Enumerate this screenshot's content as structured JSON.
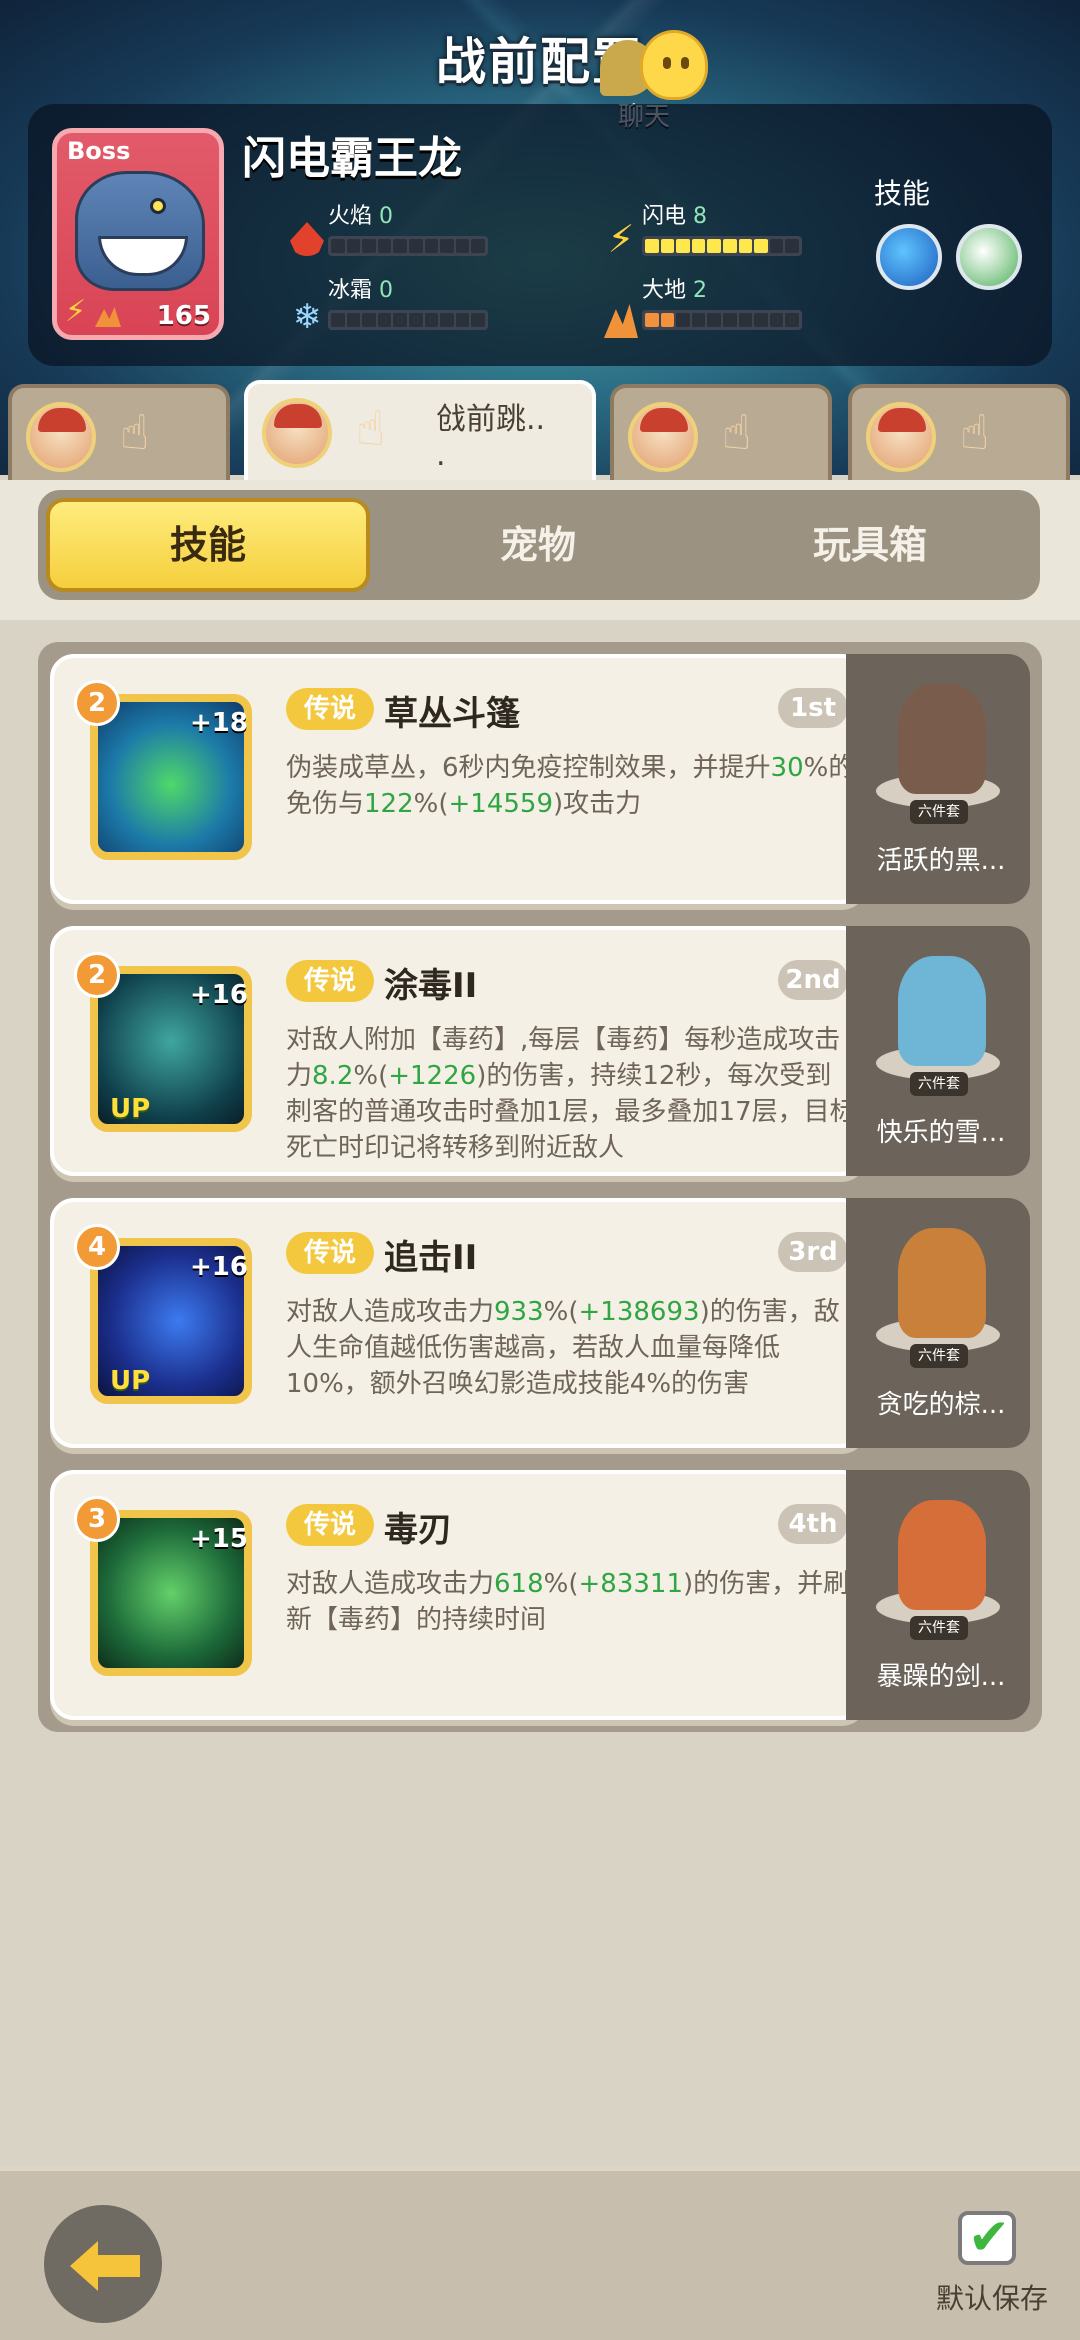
{
  "header": {
    "title": "战前配置",
    "chat_label": "聊天"
  },
  "boss": {
    "tag": "Boss",
    "name": "闪电霸王龙",
    "level": "165",
    "elements": [
      {
        "name": "火焰",
        "value": "0",
        "level": 0
      },
      {
        "name": "闪电",
        "value": "8",
        "level": 8
      },
      {
        "name": "冰霜",
        "value": "0",
        "level": 0
      },
      {
        "name": "大地",
        "value": "2",
        "level": 2
      }
    ],
    "skills_label": "技能"
  },
  "hero_tabs": [
    {
      "label": ""
    },
    {
      "label": "戗前跳..\n."
    },
    {
      "label": ""
    },
    {
      "label": ""
    }
  ],
  "subtabs": [
    "技能",
    "宠物",
    "玩具箱"
  ],
  "skills": [
    {
      "level": "2",
      "plus": "+18",
      "up": "",
      "rarity": "传说",
      "name": "草丛斗篷",
      "rank": "1st",
      "desc_parts": [
        "伪装成草丛，6秒内免疫控制效果，并提升",
        "30",
        "%的免伤与",
        "122",
        "%(",
        "+14559",
        ")攻击力"
      ],
      "pet_tag": "六件套",
      "pet_name": "活跃的黑..."
    },
    {
      "level": "2",
      "plus": "+16",
      "up": "UP",
      "rarity": "传说",
      "name": "涂毒II",
      "rank": "2nd",
      "desc_parts": [
        "对敌人附加【毒药】,每层【毒药】每秒造成攻击力",
        "8.2",
        "%(",
        "+1226",
        ")的伤害，持续12秒，每次受到刺客的普通攻击时叠加1层，最多叠加17层，目标死亡时印记将转移到附近敌人"
      ],
      "pet_tag": "六件套",
      "pet_name": "快乐的雪..."
    },
    {
      "level": "4",
      "plus": "+16",
      "up": "UP",
      "rarity": "传说",
      "name": "追击II",
      "rank": "3rd",
      "desc_parts": [
        "对敌人造成攻击力",
        "933",
        "%(",
        "+138693",
        ")的伤害，敌人生命值越低伤害越高，若敌人血量每降低10%，额外召唤幻影造成技能4%的伤害"
      ],
      "pet_tag": "六件套",
      "pet_name": "贪吃的棕..."
    },
    {
      "level": "3",
      "plus": "+15",
      "up": "",
      "rarity": "传说",
      "name": "毒刃",
      "rank": "4th",
      "desc_parts": [
        "对敌人造成攻击力",
        "618",
        "%(",
        "+83311",
        ")的伤害，并刷新【毒药】的持续时间"
      ],
      "pet_tag": "六件套",
      "pet_name": "暴躁的剑..."
    }
  ],
  "footer": {
    "save_label": "默认保存"
  }
}
